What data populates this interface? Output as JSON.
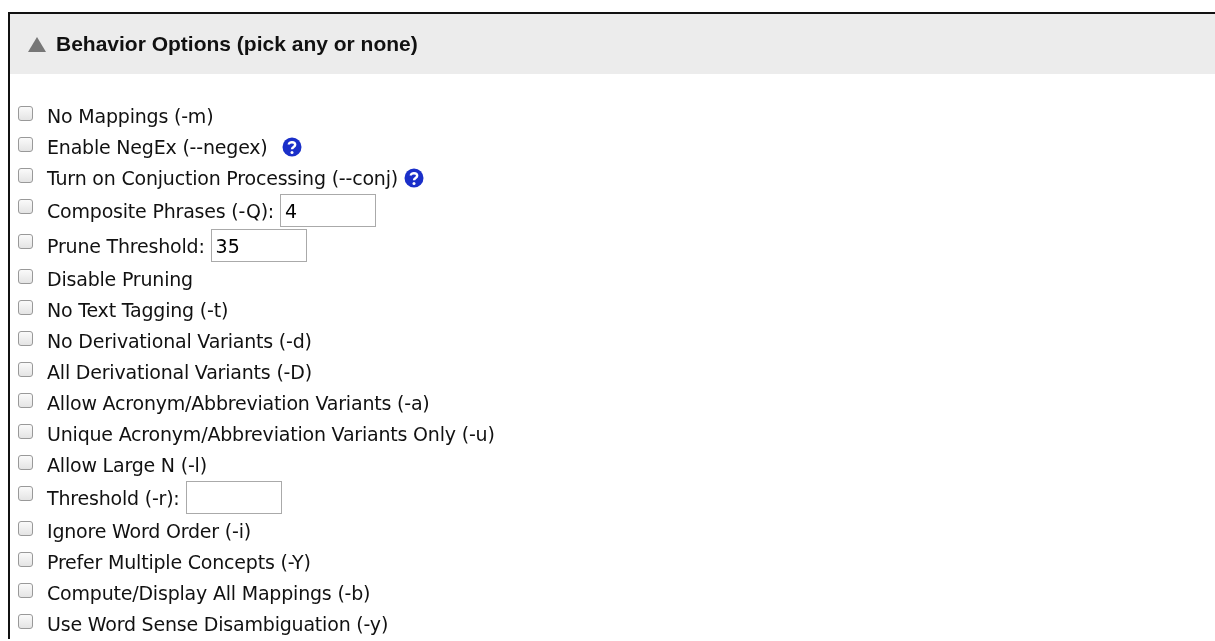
{
  "section": {
    "title": "Behavior Options (pick any or none)",
    "expanded": true
  },
  "options": [
    {
      "kind": "plain",
      "label": "No Mappings (-m)",
      "checked": false
    },
    {
      "kind": "help",
      "label": "Enable NegEx (--negex)",
      "checked": false
    },
    {
      "kind": "help",
      "label": "Turn on Conjuction Processing (--conj)",
      "checked": false
    },
    {
      "kind": "input",
      "label": "Composite Phrases (-Q):",
      "checked": false,
      "value": "4"
    },
    {
      "kind": "input",
      "label": "Prune Threshold:",
      "checked": false,
      "value": "35"
    },
    {
      "kind": "plain",
      "label": "Disable Pruning",
      "checked": false
    },
    {
      "kind": "plain",
      "label": "No Text Tagging (-t)",
      "checked": false
    },
    {
      "kind": "plain",
      "label": "No Derivational Variants (-d)",
      "checked": false
    },
    {
      "kind": "plain",
      "label": "All Derivational Variants (-D)",
      "checked": false
    },
    {
      "kind": "plain",
      "label": "Allow Acronym/Abbreviation Variants (-a)",
      "checked": false
    },
    {
      "kind": "plain",
      "label": "Unique Acronym/Abbreviation Variants Only (-u)",
      "checked": false
    },
    {
      "kind": "plain",
      "label": "Allow Large N (-l)",
      "checked": false
    },
    {
      "kind": "input",
      "label": "Threshold (-r):",
      "checked": false
    },
    {
      "kind": "plain",
      "label": "Ignore Word Order (-i)",
      "checked": false
    },
    {
      "kind": "plain",
      "label": "Prefer Multiple Concepts (-Y)",
      "checked": false
    },
    {
      "kind": "plain",
      "label": "Compute/Display All Mappings (-b)",
      "checked": false
    },
    {
      "kind": "plain",
      "label": "Use Word Sense Disambiguation (-y)",
      "checked": false
    }
  ]
}
